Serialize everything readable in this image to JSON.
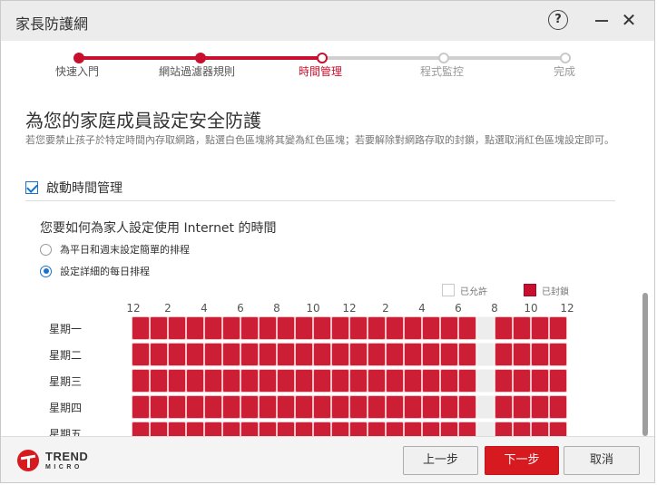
{
  "window": {
    "title": "家長防護網",
    "help_label": "?"
  },
  "steps": [
    {
      "label": "快速入門",
      "state": "done"
    },
    {
      "label": "網站過濾器規則",
      "state": "done"
    },
    {
      "label": "時間管理",
      "state": "current"
    },
    {
      "label": "程式監控",
      "state": "todo"
    },
    {
      "label": "完成",
      "state": "todo"
    }
  ],
  "main": {
    "heading": "為您的家庭成員設定安全防護",
    "description": "若您要禁止孩子於特定時間內存取網路，點選白色區塊將其變為紅色區塊；若要解除對網路存取的封鎖，點選取消紅色區塊設定即可。",
    "enable_label": "啟動時間管理",
    "enable_checked": true,
    "question": "您要如何為家人設定使用 Internet 的時間",
    "options": [
      {
        "label": "為平日和週末設定簡單的排程",
        "selected": false
      },
      {
        "label": "設定詳細的每日排程",
        "selected": true
      }
    ]
  },
  "schedule": {
    "legend_allowed": "已允許",
    "legend_blocked": "已封鎖",
    "hour_labels": [
      "12",
      "2",
      "4",
      "6",
      "8",
      "10",
      "12",
      "2",
      "4",
      "6",
      "8",
      "10",
      "12"
    ],
    "days": [
      "星期一",
      "星期二",
      "星期三",
      "星期四",
      "星期五"
    ],
    "allowed_hours": [
      19
    ],
    "colors": {
      "blocked": "#cc1f35",
      "allowed": "#ededed"
    }
  },
  "footer": {
    "brand_line1": "TREND",
    "brand_line2": "MICRO",
    "prev_label": "上一步",
    "next_label": "下一步",
    "cancel_label": "取消"
  }
}
